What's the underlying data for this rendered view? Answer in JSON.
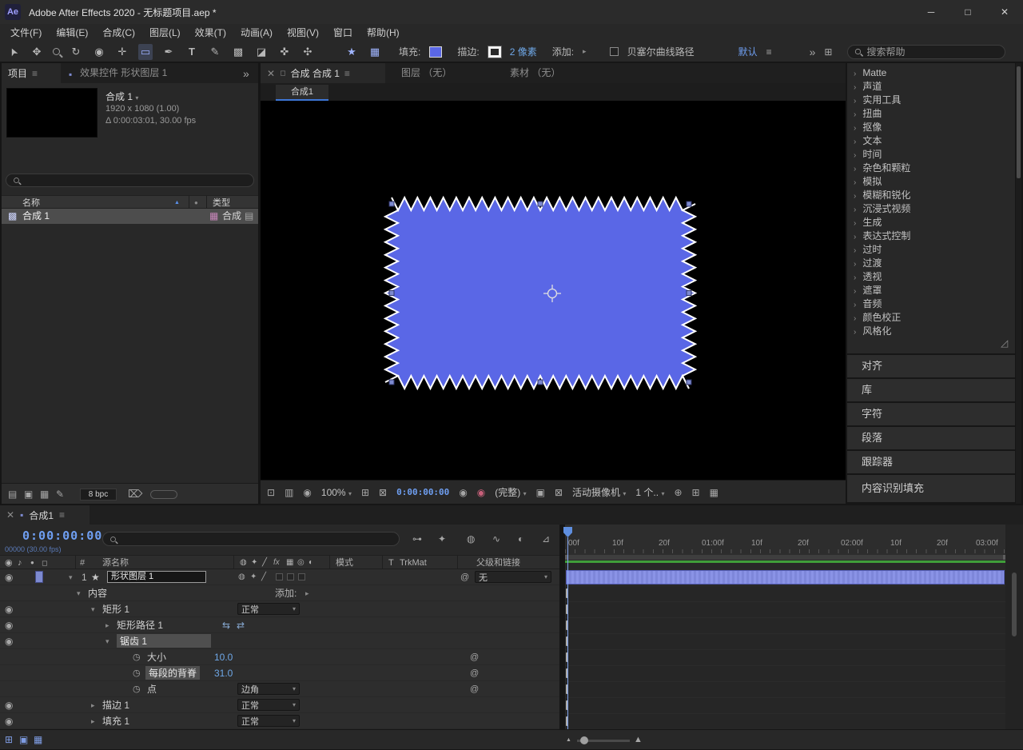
{
  "titlebar": {
    "icon": "Ae",
    "title": "Adobe After Effects 2020 - 无标题项目.aep *",
    "minimize": "─",
    "maximize": "□",
    "close": "✕"
  },
  "menubar": {
    "items": [
      "文件(F)",
      "编辑(E)",
      "合成(C)",
      "图层(L)",
      "效果(T)",
      "动画(A)",
      "视图(V)",
      "窗口",
      "帮助(H)"
    ]
  },
  "toolbar": {
    "fill_label": "填充:",
    "stroke_label": "描边:",
    "stroke_width": "2 像素",
    "add_label": "添加:",
    "bezier_label": "贝塞尔曲线路径",
    "workspace_label": "默认",
    "search_placeholder": "搜索帮助"
  },
  "project": {
    "tab_project": "项目",
    "tab_effect_controls": "效果控件 形状图层 1",
    "comp_name": "合成 1",
    "comp_resolution": "1920 x 1080 (1.00)",
    "comp_duration": "Δ 0:00:03:01, 30.00 fps",
    "col_name": "名称",
    "col_type": "类型",
    "item_name": "合成 1",
    "item_type": "合成",
    "bpc": "8 bpc"
  },
  "viewer": {
    "tab_comp": "合成 合成 1",
    "tab_layer": "图层 （无）",
    "tab_footage": "素材 （无）",
    "comp_tab": "合成1",
    "zoom": "100%",
    "time": "0:00:00:00",
    "resolution": "(完整)",
    "camera": "活动摄像机",
    "views": "1 个.."
  },
  "effects_panel": {
    "categories": [
      "Matte",
      "声道",
      "实用工具",
      "扭曲",
      "抠像",
      "文本",
      "时间",
      "杂色和颗粒",
      "模拟",
      "模糊和锐化",
      "沉浸式视频",
      "生成",
      "表达式控制",
      "过时",
      "过渡",
      "透视",
      "遮罩",
      "音频",
      "颜色校正",
      "风格化"
    ]
  },
  "side_panels": {
    "items": [
      "对齐",
      "库",
      "字符",
      "段落",
      "跟踪器",
      "内容识别填充"
    ]
  },
  "timeline": {
    "tab": "合成1",
    "time": "0:00:00:00",
    "frame_info": "00000 (30.00 fps)",
    "add_label": "添加:",
    "headers": {
      "num": "#",
      "source": "源名称",
      "mode": "模式",
      "t": "T",
      "trkmat": "TrkMat",
      "parent": "父级和链接"
    },
    "rows": [
      {
        "num": "1",
        "name": "形状图层 1",
        "parent": "无"
      },
      {
        "name": "内容"
      },
      {
        "name": "矩形 1",
        "mode": "正常"
      },
      {
        "name": "矩形路径 1"
      },
      {
        "name": "锯齿 1"
      },
      {
        "name": "大小",
        "value": "10.0"
      },
      {
        "name": "每段的背脊",
        "value": "31.0"
      },
      {
        "name": "点",
        "mode": "边角"
      },
      {
        "name": "描边 1",
        "mode": "正常"
      },
      {
        "name": "填充 1",
        "mode": "正常"
      }
    ],
    "ruler": [
      "00f",
      "10f",
      "20f",
      "01:00f",
      "10f",
      "20f",
      "02:00f",
      "10f",
      "20f",
      "03:00f"
    ]
  },
  "canvas": {
    "shape_fill": "#5a67e6",
    "shape_stroke": "#ffffff",
    "handle_fill": "#7d8ad0",
    "handle_stroke": "#2e3468"
  },
  "colors": {
    "accent": "#3d76d6",
    "value_text": "#6fa8e8",
    "time_text": "#6f9ff2",
    "cache_green": "#3f9e3a",
    "layer_bar": "#7e88db"
  },
  "icons": {
    "eye": "◉",
    "audio": "♪",
    "solo": "●",
    "lock": "◻",
    "menu": "≡",
    "close": "✕",
    "overflow": "»",
    "open": "▾",
    "tri": "▸",
    "caret": "▾",
    "star": "★",
    "grid": "▦",
    "selection": "➤",
    "hand": "✥",
    "rotate": "↻",
    "camera": "◉",
    "pan": "✛",
    "rect": "▭",
    "pen": "✒",
    "type": "T",
    "brush": "✎",
    "stamp": "▩",
    "eraser": "◪",
    "roto": "✜",
    "puppet": "✣",
    "shy": "◍",
    "collapse": "✦",
    "quality": "╱",
    "fx": "fx",
    "fblend": "▦",
    "mblur": "◎",
    "adj": "◐",
    "cube": "⊞",
    "stopwatch": "◷",
    "pickwhip": "@",
    "swap": "⇆",
    "swap2": "⇄",
    "trash": "⌦",
    "pencil": "✎",
    "folder": "▣",
    "compicon": "▦",
    "film": "▤",
    "thumb": "▩",
    "chev": "›",
    "grab": "◿",
    "sort": "▲",
    "dot": "●",
    "chip": "▪",
    "monitor": "⊡",
    "mini": "▥",
    "crop": "⊠",
    "target": "⊕",
    "tl_controls": [
      "⊶",
      "✦",
      "◍",
      "∿",
      "◐",
      "⊿"
    ],
    "bl1": "⊞",
    "bl2": "▣",
    "bl3": "▦",
    "mtn": "▲"
  }
}
